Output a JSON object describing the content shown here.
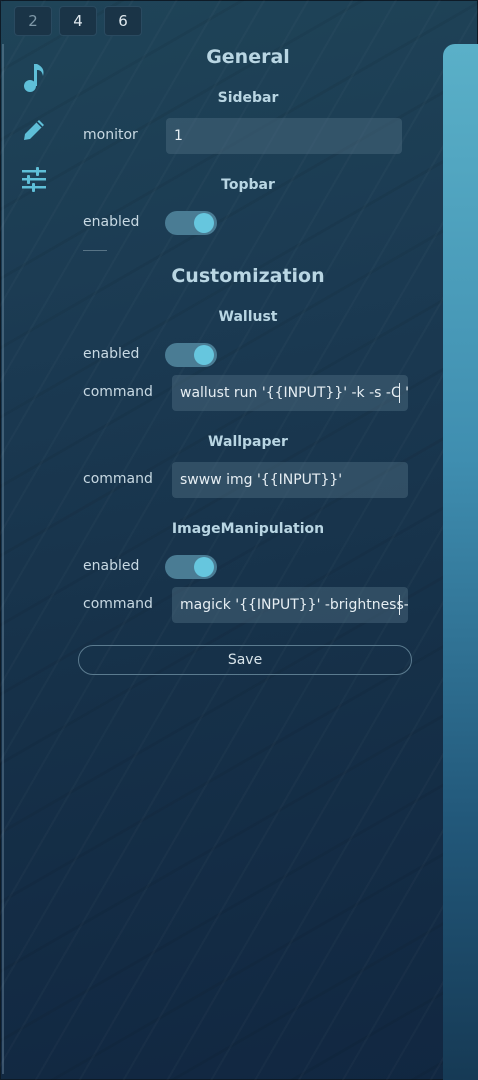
{
  "workspaces": [
    {
      "label": "2",
      "active": false
    },
    {
      "label": "4",
      "active": true
    },
    {
      "label": "6",
      "active": true
    }
  ],
  "nav_icons": [
    "music-note-icon",
    "pencil-icon",
    "sliders-icon"
  ],
  "general": {
    "title": "General",
    "sidebar": {
      "title": "Sidebar",
      "monitor_label": "monitor",
      "monitor_value": "1"
    },
    "topbar": {
      "title": "Topbar",
      "enabled_label": "enabled",
      "enabled": true
    }
  },
  "customization": {
    "title": "Customization",
    "wallust": {
      "title": "Wallust",
      "enabled_label": "enabled",
      "enabled": true,
      "command_label": "command",
      "command_value": "wallust run '{{INPUT}}' -k -s -C '{{C"
    },
    "wallpaper": {
      "title": "Wallpaper",
      "command_label": "command",
      "command_value": "swww img '{{INPUT}}'"
    },
    "image_manipulation": {
      "title": "ImageManipulation",
      "enabled_label": "enabled",
      "enabled": true,
      "command_label": "command",
      "command_value": "magick '{{INPUT}}' -brightness-co"
    }
  },
  "save_label": "Save",
  "colors": {
    "accent": "#66c6de",
    "toggle_track": "#4a7c94",
    "text": "#b9d6e3"
  }
}
